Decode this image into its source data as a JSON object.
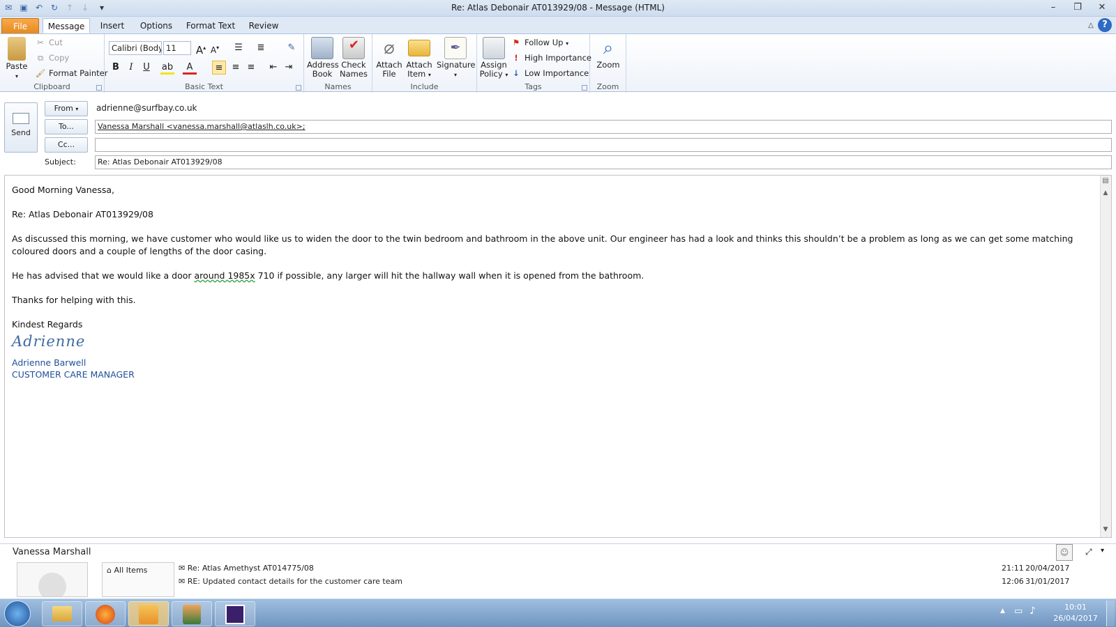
{
  "window": {
    "title": "Re: Atlas Debonair AT013929/08  -  Message (HTML)"
  },
  "tabs": [
    "File",
    "Message",
    "Insert",
    "Options",
    "Format Text",
    "Review"
  ],
  "ribbon": {
    "clipboard": {
      "label": "Clipboard",
      "paste": "Paste",
      "cut": "Cut",
      "copy": "Copy",
      "format_painter": "Format Painter"
    },
    "basic_text": {
      "label": "Basic Text",
      "font": "Calibri (Body)",
      "size": "11",
      "bold": "B",
      "italic": "I",
      "underline": "U"
    },
    "names": {
      "label": "Names",
      "address_book": "Address Book",
      "check_names": "Check Names"
    },
    "include": {
      "label": "Include",
      "attach_file": "Attach File",
      "attach_item": "Attach Item",
      "signature": "Signature"
    },
    "tags": {
      "label": "Tags",
      "assign_policy": "Assign Policy",
      "follow_up": "Follow Up",
      "high_importance": "High Importance",
      "low_importance": "Low Importance"
    },
    "zoom": {
      "label": "Zoom",
      "zoom": "Zoom"
    }
  },
  "header": {
    "send": "Send",
    "from_btn": "From",
    "from_value": "adrienne@surfbay.co.uk",
    "to_btn": "To...",
    "to_value": "Vanessa Marshall <vanessa.marshall@atlaslh.co.uk>;",
    "cc_btn": "Cc...",
    "cc_value": "",
    "subject_label": "Subject:",
    "subject_value": "Re: Atlas Debonair AT013929/08"
  },
  "body": {
    "greeting": "Good Morning Vanessa,",
    "re_line": "Re: Atlas Debonair AT013929/08",
    "para1": "As discussed this morning, we have customer who would like us to widen the door to the twin bedroom and bathroom in the above unit.  Our engineer has had a look and thinks this shouldn’t be a problem as long as we can get some matching coloured doors and a couple of lengths of the door casing.",
    "para2_a": "He has advised that we would like a door ",
    "para2_b": "around  1985x",
    "para2_c": " 710 if possible, any larger will hit the hallway wall when it is opened from the bathroom.",
    "thanks": "Thanks for helping with this.",
    "regards": "Kindest Regards",
    "signature_script": "Adrienne",
    "sig_name": "Adrienne Barwell",
    "sig_title": "CUSTOMER CARE MANAGER"
  },
  "people_pane": {
    "name": "Vanessa Marshall",
    "all_items": "All Items",
    "items": [
      {
        "subject": "Re: Atlas Amethyst AT014775/08",
        "time": "21:11",
        "date": "20/04/2017"
      },
      {
        "subject": "RE: Updated contact details for the customer care team",
        "time": "12:06",
        "date": "31/01/2017"
      }
    ]
  },
  "taskbar": {
    "time": "10:01",
    "date": "26/04/2017"
  }
}
